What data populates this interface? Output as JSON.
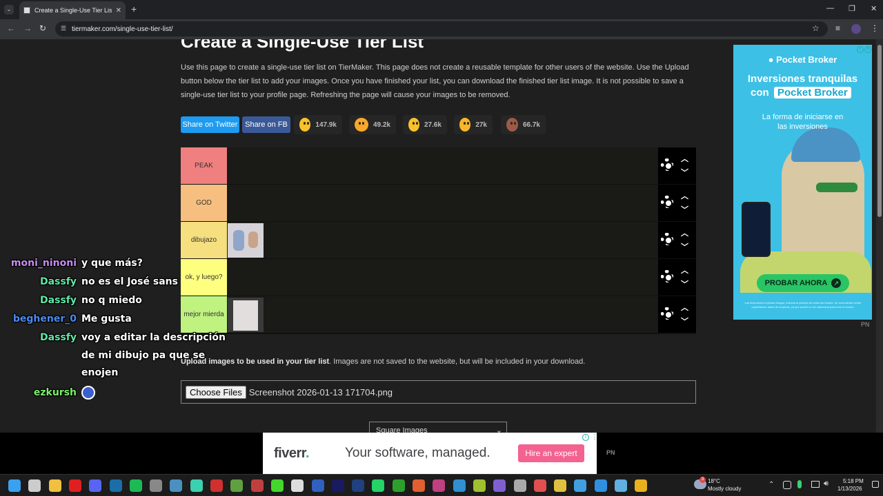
{
  "browser": {
    "tab_title": "Create a Single-Use Tier List (Pi",
    "url": "tiermaker.com/single-use-tier-list/"
  },
  "page": {
    "title": "Create a Single-Use Tier List",
    "description": "Use this page to create a single-use tier list on TierMaker. This page does not create a reusable template for other users of the website. Use the Upload button below the tier list to add your images. Once you have finished your list, you can download the finished tier list image. It is not possible to save a single-use tier list to your profile page. Refreshing the page will cause your images to be removed.",
    "share_twitter": "Share on Twitter",
    "share_fb": "Share on FB",
    "reactions": [
      {
        "icon": "smiling-face-icon",
        "count": "147.9k",
        "color": "#f7c22b"
      },
      {
        "icon": "heart-eyes-face-icon",
        "count": "49.2k",
        "color": "#f7a82b"
      },
      {
        "icon": "laughing-face-icon",
        "count": "27.6k",
        "color": "#f7c22b"
      },
      {
        "icon": "raised-hands-icon",
        "count": "27k",
        "color": "#f7b62b"
      },
      {
        "icon": "poop-icon",
        "count": "66.7k",
        "color": "#9b5a4a"
      }
    ],
    "tiers": [
      {
        "label": "PEAK",
        "color": "#f07f7f",
        "has_image": false
      },
      {
        "label": "GOD",
        "color": "#f6bf7f",
        "has_image": false
      },
      {
        "label": "dibujazo",
        "color": "#f6df7f",
        "has_image": true
      },
      {
        "label": "ok, y luego?",
        "color": "#fefe7f",
        "has_image": false
      },
      {
        "label": "mejor mierda",
        "color": "#bff27f",
        "has_image": true
      }
    ],
    "upload_bold": "Upload images to be used in your tier list",
    "upload_rest": ". Images are not saved to the website, but will be included in your download.",
    "choose_files": "Choose Files",
    "file_name": "Screenshot 2026-01-13 171704.png",
    "image_shape_select": "Square Images"
  },
  "ads": {
    "right": {
      "brand": "Pocket Broker",
      "headline_1": "Inversiones tranquilas",
      "headline_2_prefix": "con",
      "headline_2_brand": "Pocket Broker",
      "subtitle": "La forma de iniciarse en las inversiones",
      "cta": "PROBAR AHORA",
      "fine_print": "Las inversiones implican riesgos, incluida la pérdida de todos los fondos. Se recomienda recibir capacitación antes de empezar, ya que puede no ser adecuada para todo el mundo.",
      "tag": "PN"
    },
    "bottom": {
      "logo": "fiverr",
      "logo_dot": ".",
      "text": "Your software, managed.",
      "cta": "Hire an expert",
      "tag": "PN"
    }
  },
  "chat": [
    {
      "user": "moni_ninoni",
      "color": "#c78cf0",
      "message": "y que más?"
    },
    {
      "user": "Dassfy",
      "color": "#5ee8a7",
      "message": "no es el José sans"
    },
    {
      "user": "Dassfy",
      "color": "#5ee8a7",
      "message": "no q miedo"
    },
    {
      "user": "beghener_0",
      "color": "#4a8cf0",
      "message": "Me gusta"
    },
    {
      "user": "Dassfy",
      "color": "#5ee8a7",
      "message": "voy a editar la descripción"
    },
    {
      "user": "",
      "color": "#ffffff",
      "message": "de mi dibujo pa que se"
    },
    {
      "user": "",
      "color": "#ffffff",
      "message": "enojen"
    },
    {
      "user": "ezkursh",
      "color": "#7af06a",
      "message": ""
    }
  ],
  "taskbar": {
    "weather_temp": "18°C",
    "weather_desc": "Mostly cloudy",
    "time": "5:18 PM",
    "date": "1/13/2026",
    "weather_badge": "3"
  }
}
